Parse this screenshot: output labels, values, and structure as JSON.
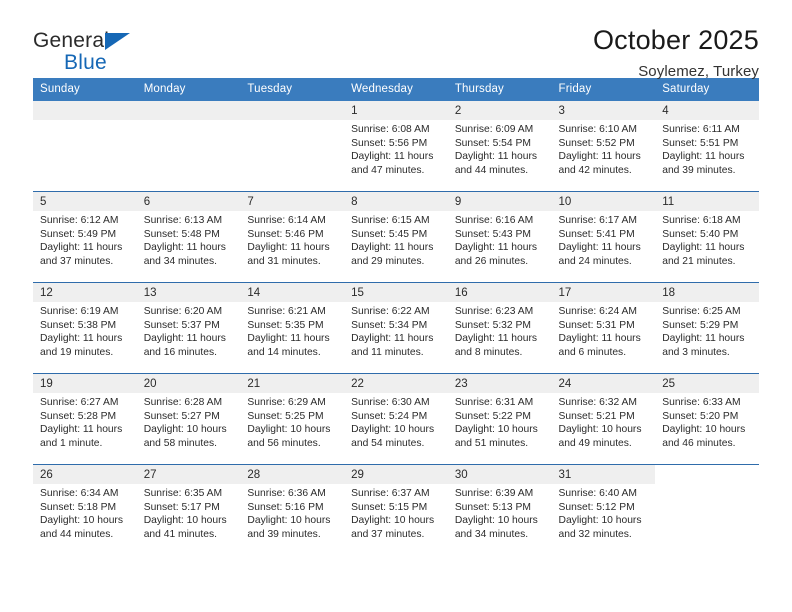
{
  "logo": {
    "word1": "General",
    "word2": "Blue",
    "triangle_icon": "blue-triangle-icon",
    "accent_color": "#1567b5"
  },
  "header": {
    "title": "October 2025",
    "subtitle": "Soylemez, Turkey"
  },
  "colors": {
    "header_row_bg": "#3a7cbe",
    "header_row_text": "#ffffff",
    "daynum_band_bg": "#efefef",
    "row_divider": "#2f6cab",
    "body_text": "#2b2b2b"
  },
  "calendar": {
    "weekday_headers": [
      "Sunday",
      "Monday",
      "Tuesday",
      "Wednesday",
      "Thursday",
      "Friday",
      "Saturday"
    ],
    "labels": {
      "sunrise": "Sunrise:",
      "sunset": "Sunset:",
      "daylight": "Daylight:"
    },
    "weeks": [
      [
        {
          "day": "",
          "blank": true
        },
        {
          "day": "",
          "blank": true
        },
        {
          "day": "",
          "blank": true
        },
        {
          "day": "1",
          "sunrise": "Sunrise: 6:08 AM",
          "sunset": "Sunset: 5:56 PM",
          "daylight_line1": "Daylight: 11 hours",
          "daylight_line2": "and 47 minutes."
        },
        {
          "day": "2",
          "sunrise": "Sunrise: 6:09 AM",
          "sunset": "Sunset: 5:54 PM",
          "daylight_line1": "Daylight: 11 hours",
          "daylight_line2": "and 44 minutes."
        },
        {
          "day": "3",
          "sunrise": "Sunrise: 6:10 AM",
          "sunset": "Sunset: 5:52 PM",
          "daylight_line1": "Daylight: 11 hours",
          "daylight_line2": "and 42 minutes."
        },
        {
          "day": "4",
          "sunrise": "Sunrise: 6:11 AM",
          "sunset": "Sunset: 5:51 PM",
          "daylight_line1": "Daylight: 11 hours",
          "daylight_line2": "and 39 minutes."
        }
      ],
      [
        {
          "day": "5",
          "sunrise": "Sunrise: 6:12 AM",
          "sunset": "Sunset: 5:49 PM",
          "daylight_line1": "Daylight: 11 hours",
          "daylight_line2": "and 37 minutes."
        },
        {
          "day": "6",
          "sunrise": "Sunrise: 6:13 AM",
          "sunset": "Sunset: 5:48 PM",
          "daylight_line1": "Daylight: 11 hours",
          "daylight_line2": "and 34 minutes."
        },
        {
          "day": "7",
          "sunrise": "Sunrise: 6:14 AM",
          "sunset": "Sunset: 5:46 PM",
          "daylight_line1": "Daylight: 11 hours",
          "daylight_line2": "and 31 minutes."
        },
        {
          "day": "8",
          "sunrise": "Sunrise: 6:15 AM",
          "sunset": "Sunset: 5:45 PM",
          "daylight_line1": "Daylight: 11 hours",
          "daylight_line2": "and 29 minutes."
        },
        {
          "day": "9",
          "sunrise": "Sunrise: 6:16 AM",
          "sunset": "Sunset: 5:43 PM",
          "daylight_line1": "Daylight: 11 hours",
          "daylight_line2": "and 26 minutes."
        },
        {
          "day": "10",
          "sunrise": "Sunrise: 6:17 AM",
          "sunset": "Sunset: 5:41 PM",
          "daylight_line1": "Daylight: 11 hours",
          "daylight_line2": "and 24 minutes."
        },
        {
          "day": "11",
          "sunrise": "Sunrise: 6:18 AM",
          "sunset": "Sunset: 5:40 PM",
          "daylight_line1": "Daylight: 11 hours",
          "daylight_line2": "and 21 minutes."
        }
      ],
      [
        {
          "day": "12",
          "sunrise": "Sunrise: 6:19 AM",
          "sunset": "Sunset: 5:38 PM",
          "daylight_line1": "Daylight: 11 hours",
          "daylight_line2": "and 19 minutes."
        },
        {
          "day": "13",
          "sunrise": "Sunrise: 6:20 AM",
          "sunset": "Sunset: 5:37 PM",
          "daylight_line1": "Daylight: 11 hours",
          "daylight_line2": "and 16 minutes."
        },
        {
          "day": "14",
          "sunrise": "Sunrise: 6:21 AM",
          "sunset": "Sunset: 5:35 PM",
          "daylight_line1": "Daylight: 11 hours",
          "daylight_line2": "and 14 minutes."
        },
        {
          "day": "15",
          "sunrise": "Sunrise: 6:22 AM",
          "sunset": "Sunset: 5:34 PM",
          "daylight_line1": "Daylight: 11 hours",
          "daylight_line2": "and 11 minutes."
        },
        {
          "day": "16",
          "sunrise": "Sunrise: 6:23 AM",
          "sunset": "Sunset: 5:32 PM",
          "daylight_line1": "Daylight: 11 hours",
          "daylight_line2": "and 8 minutes."
        },
        {
          "day": "17",
          "sunrise": "Sunrise: 6:24 AM",
          "sunset": "Sunset: 5:31 PM",
          "daylight_line1": "Daylight: 11 hours",
          "daylight_line2": "and 6 minutes."
        },
        {
          "day": "18",
          "sunrise": "Sunrise: 6:25 AM",
          "sunset": "Sunset: 5:29 PM",
          "daylight_line1": "Daylight: 11 hours",
          "daylight_line2": "and 3 minutes."
        }
      ],
      [
        {
          "day": "19",
          "sunrise": "Sunrise: 6:27 AM",
          "sunset": "Sunset: 5:28 PM",
          "daylight_line1": "Daylight: 11 hours",
          "daylight_line2": "and 1 minute."
        },
        {
          "day": "20",
          "sunrise": "Sunrise: 6:28 AM",
          "sunset": "Sunset: 5:27 PM",
          "daylight_line1": "Daylight: 10 hours",
          "daylight_line2": "and 58 minutes."
        },
        {
          "day": "21",
          "sunrise": "Sunrise: 6:29 AM",
          "sunset": "Sunset: 5:25 PM",
          "daylight_line1": "Daylight: 10 hours",
          "daylight_line2": "and 56 minutes."
        },
        {
          "day": "22",
          "sunrise": "Sunrise: 6:30 AM",
          "sunset": "Sunset: 5:24 PM",
          "daylight_line1": "Daylight: 10 hours",
          "daylight_line2": "and 54 minutes."
        },
        {
          "day": "23",
          "sunrise": "Sunrise: 6:31 AM",
          "sunset": "Sunset: 5:22 PM",
          "daylight_line1": "Daylight: 10 hours",
          "daylight_line2": "and 51 minutes."
        },
        {
          "day": "24",
          "sunrise": "Sunrise: 6:32 AM",
          "sunset": "Sunset: 5:21 PM",
          "daylight_line1": "Daylight: 10 hours",
          "daylight_line2": "and 49 minutes."
        },
        {
          "day": "25",
          "sunrise": "Sunrise: 6:33 AM",
          "sunset": "Sunset: 5:20 PM",
          "daylight_line1": "Daylight: 10 hours",
          "daylight_line2": "and 46 minutes."
        }
      ],
      [
        {
          "day": "26",
          "sunrise": "Sunrise: 6:34 AM",
          "sunset": "Sunset: 5:18 PM",
          "daylight_line1": "Daylight: 10 hours",
          "daylight_line2": "and 44 minutes."
        },
        {
          "day": "27",
          "sunrise": "Sunrise: 6:35 AM",
          "sunset": "Sunset: 5:17 PM",
          "daylight_line1": "Daylight: 10 hours",
          "daylight_line2": "and 41 minutes."
        },
        {
          "day": "28",
          "sunrise": "Sunrise: 6:36 AM",
          "sunset": "Sunset: 5:16 PM",
          "daylight_line1": "Daylight: 10 hours",
          "daylight_line2": "and 39 minutes."
        },
        {
          "day": "29",
          "sunrise": "Sunrise: 6:37 AM",
          "sunset": "Sunset: 5:15 PM",
          "daylight_line1": "Daylight: 10 hours",
          "daylight_line2": "and 37 minutes."
        },
        {
          "day": "30",
          "sunrise": "Sunrise: 6:39 AM",
          "sunset": "Sunset: 5:13 PM",
          "daylight_line1": "Daylight: 10 hours",
          "daylight_line2": "and 34 minutes."
        },
        {
          "day": "31",
          "sunrise": "Sunrise: 6:40 AM",
          "sunset": "Sunset: 5:12 PM",
          "daylight_line1": "Daylight: 10 hours",
          "daylight_line2": "and 32 minutes."
        },
        {
          "day": "",
          "empty_nofill": true
        }
      ]
    ]
  }
}
